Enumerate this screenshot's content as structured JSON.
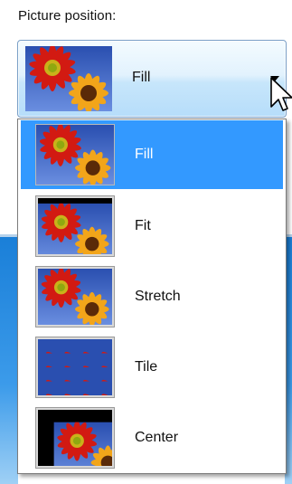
{
  "picture_position": {
    "label": "Picture position:",
    "selected": "Fill",
    "options": [
      "Fill",
      "Fit",
      "Stretch",
      "Tile",
      "Center"
    ],
    "highlighted_index": 0
  },
  "icons": {
    "dropdown_arrow": "chevron-down-icon",
    "cursor": "mouse-pointer-icon",
    "thumbnail": "flower-wallpaper-thumbnail"
  },
  "colors": {
    "selection": "#3399ff",
    "combo_border": "#7a9fc7"
  }
}
